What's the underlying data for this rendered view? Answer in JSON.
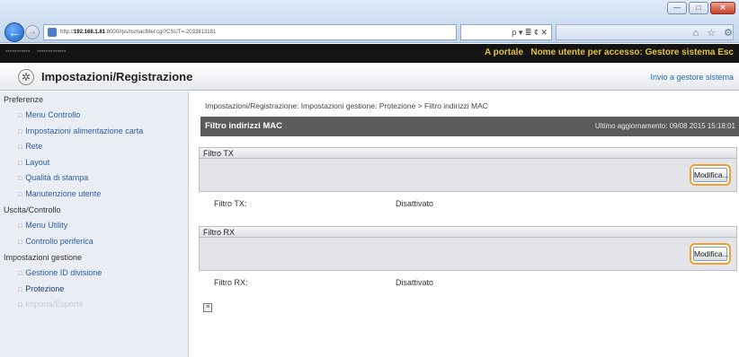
{
  "browser": {
    "url_prefix": "http://",
    "url_host": "192.168.1.81",
    "url_rest": ":8000/rps/nsmacfilter.cgi?CSUT=-2033813181",
    "tools_text": "ρ ▾ ≣ ¢ ✕",
    "top_icons": "⌂ ☆ ⚙",
    "back_icon": "←",
    "forward_icon": "→",
    "window_minimize": "—",
    "window_maximize": "□",
    "window_close": "✕"
  },
  "app_bar": {
    "portal_link": "A portale",
    "user_label": "Nome utente per accesso: Gestore sistema Esc"
  },
  "title_bar": {
    "title": "Impostazioni/Registrazione",
    "link": "Invio a gestore sistema"
  },
  "sidebar": {
    "groups": [
      {
        "heading": "Preferenze",
        "items": [
          {
            "label": "Menu Controllo"
          },
          {
            "label": "Impostazioni alimentazione carta"
          },
          {
            "label": "Rete"
          },
          {
            "label": "Layout"
          },
          {
            "label": "Qualità di stampa"
          },
          {
            "label": "Manutenzione utente"
          }
        ]
      },
      {
        "heading": "Uscita/Controllo",
        "items": [
          {
            "label": "Menu Utility"
          },
          {
            "label": "Controllo periferica"
          }
        ]
      },
      {
        "heading": "Impostazioni gestione",
        "items": [
          {
            "label": "Gestione ID divisione"
          },
          {
            "label": "Protezione"
          },
          {
            "label": "Importa/Esporta"
          }
        ]
      }
    ]
  },
  "main": {
    "breadcrumb": "Impostazioni/Registrazione: Impostazioni gestione: Protezione > Filtro indirizzi MAC",
    "panel_title": "Filtro indirizzi MAC",
    "last_updated": "Ultimo aggiornamento: 09/08 2015 15:18:01",
    "tx": {
      "section_title": "Filtro TX",
      "edit_label": "Modifica...",
      "field_label": "Filtro TX:",
      "field_value": "Disattivato"
    },
    "rx": {
      "section_title": "Filtro RX",
      "edit_label": "Modifica...",
      "field_label": "Filtro RX:",
      "field_value": "Disattivato"
    },
    "footer_icon": "≡"
  },
  "colors": {
    "highlight": "#f0a030",
    "panel_header": "#5b5b5b",
    "app_bar": "#141414",
    "link": "#2b5ea3"
  }
}
